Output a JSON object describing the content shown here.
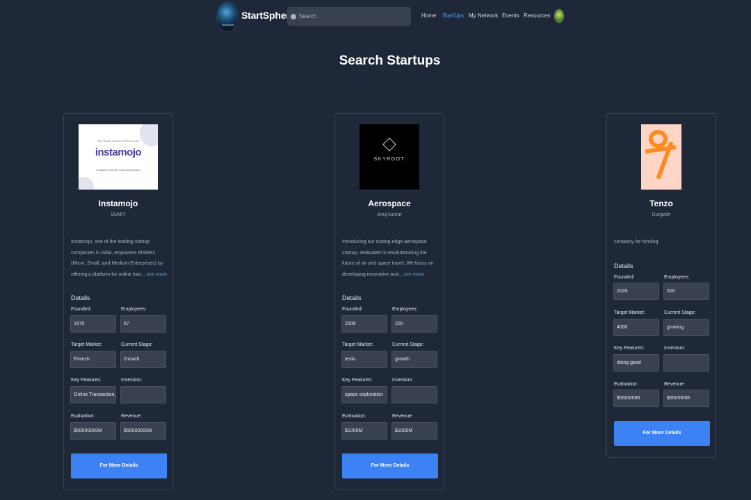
{
  "nav": {
    "brand": "StartSphere",
    "search_placeholder": "Search",
    "links": [
      "Home",
      "StartUps",
      "My Network",
      "Events",
      "Resources"
    ],
    "active_link": "StartUps"
  },
  "page_title": "Search Startups",
  "labels": {
    "details": "Details",
    "founded": "Founded:",
    "employees": "Employees:",
    "target_market": "Target Market:",
    "current_stage": "Current Stage:",
    "key_features": "Key Features:",
    "investors": "Investors:",
    "evaluation": "Evaluation:",
    "revenue": "Revenue:",
    "button": "For More Details",
    "see_more": "see more"
  },
  "startups": [
    {
      "name": "Instamojo",
      "founder": "SUMIT",
      "description": "Instamojo, one of the leading startup companies in India, empowers MSMEs (Micro, Small, and Medium Enterprises) by offering a platform for online tran...",
      "founded": "1970",
      "employees": "67",
      "target_market": "Fintech",
      "current_stage": "Growth",
      "key_features": "Online Transaction, Pay",
      "investors": "",
      "evaluation": "$50000000M",
      "revenue": "$50000000M",
      "logo_text": "instamojo",
      "logo_tagline": "Start, Manage, and Grow Your Business with",
      "logo_subline": "POWERING 1,500,000+ INDIAN BUSINESSES"
    },
    {
      "name": "Aerospace",
      "founder": "Anuj kumar",
      "description": "Introducing our cutting-edge aerospace startup, dedicated to revolutionizing the future of air and space travel. We focus on developing innovative and...",
      "founded": "2006",
      "employees": "200",
      "target_market": "tesla",
      "current_stage": "growth",
      "key_features": "space exploration",
      "investors": "",
      "evaluation": "$1000M",
      "revenue": "$1000M",
      "logo_text": "SKYROOT"
    },
    {
      "name": "Tenzo",
      "founder": "Durgesh",
      "description": "company for funding",
      "founded": "2020",
      "employees": "500",
      "target_market": "4000",
      "current_stage": "growing",
      "key_features": "doing good",
      "investors": "",
      "evaluation": "$560000M",
      "revenue": "$560000M"
    }
  ]
}
